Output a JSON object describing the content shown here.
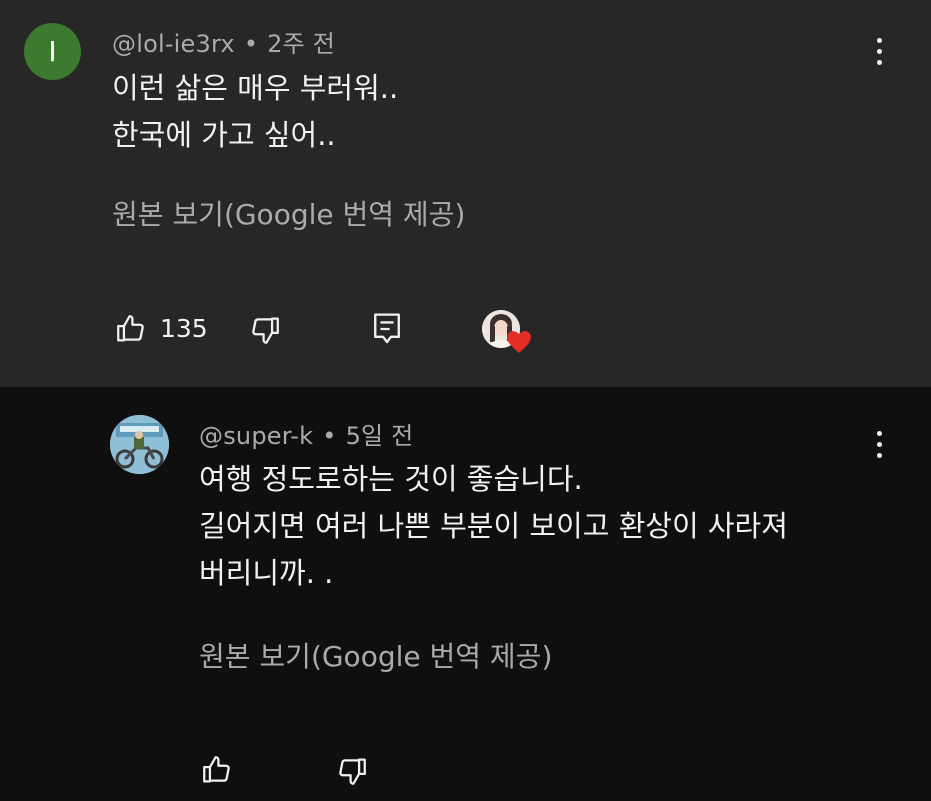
{
  "comments": [
    {
      "avatar_letter": "I",
      "avatar_color": "#3b7a2f",
      "author": "@lol-ie3rx",
      "separator": "•",
      "time": "2주 전",
      "text": "이런 삶은 매우 부러워..\n한국에 가고 싶어..",
      "see_original": "원본 보기(Google 번역 제공)",
      "like_count": "135",
      "icons": [
        "like-icon",
        "dislike-icon",
        "reply-icon",
        "creator-heart-icon",
        "more-vert-icon"
      ]
    },
    {
      "author": "@super-k",
      "separator": "•",
      "time": "5일 전",
      "text": "여행 정도로하는 것이 좋습니다.\n길어지면 여러 나쁜 부분이 보이고 환상이 사라져\n버리니까. .",
      "see_original": "원본 보기(Google 번역 제공)",
      "icons": [
        "like-icon",
        "dislike-icon",
        "more-vert-icon"
      ]
    }
  ],
  "colors": {
    "highlight_bg": "#272727",
    "page_bg": "#0f0f0f",
    "secondary_text": "#aaaaaa",
    "heart": "#e52d27"
  }
}
